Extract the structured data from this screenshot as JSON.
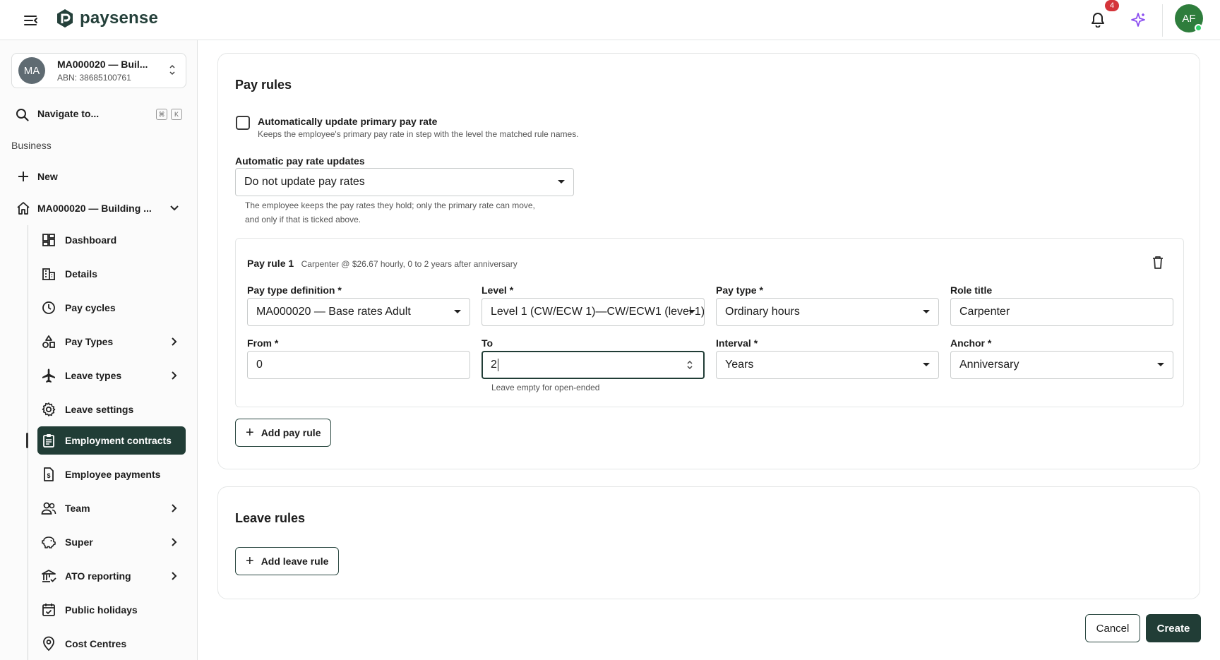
{
  "header": {
    "logo_text": "paysense",
    "notification_count": "4",
    "user_initials": "AF"
  },
  "sidebar": {
    "business": {
      "initials": "MA",
      "name": "MA000020 — Buil...",
      "abn": "ABN: 38685100761"
    },
    "navigate": {
      "label": "Navigate to...",
      "key1": "⌘",
      "key2": "K"
    },
    "section_label": "Business",
    "new_label": "New",
    "company_label": "MA000020 — Building ...",
    "items": [
      {
        "label": "Dashboard"
      },
      {
        "label": "Details"
      },
      {
        "label": "Pay cycles"
      },
      {
        "label": "Pay Types"
      },
      {
        "label": "Leave types"
      },
      {
        "label": "Leave settings"
      },
      {
        "label": "Employment contracts"
      },
      {
        "label": "Employee payments"
      },
      {
        "label": "Team"
      },
      {
        "label": "Super"
      },
      {
        "label": "ATO reporting"
      },
      {
        "label": "Public holidays"
      },
      {
        "label": "Cost Centres"
      }
    ]
  },
  "pay_rules": {
    "title": "Pay rules",
    "auto_update_label": "Automatically update primary pay rate",
    "auto_update_help": "Keeps the employee's primary pay rate in step with the level the matched rule names.",
    "auto_updates_label": "Automatic pay rate updates",
    "auto_updates_value": "Do not update pay rates",
    "auto_updates_help_1": "The employee keeps the pay rates they hold; only the primary rate can move,",
    "auto_updates_help_2": "and only if that is ticked above.",
    "rule": {
      "title": "Pay rule 1",
      "summary": "Carpenter @ $26.67 hourly, 0 to 2 years after anniversary",
      "pay_type_def_label": "Pay type definition *",
      "pay_type_def_value": "MA000020 — Base rates Adult",
      "level_label": "Level *",
      "level_value": "Level 1 (CW/ECW 1)—CW/ECW1 (level 1)",
      "pay_type_label": "Pay type *",
      "pay_type_value": "Ordinary hours",
      "role_title_label": "Role title",
      "role_title_value": "Carpenter",
      "from_label": "From *",
      "from_value": "0",
      "to_label": "To",
      "to_value": "2",
      "to_help": "Leave empty for open-ended",
      "interval_label": "Interval *",
      "interval_value": "Years",
      "anchor_label": "Anchor *",
      "anchor_value": "Anniversary"
    },
    "add_button": "Add pay rule"
  },
  "leave_rules": {
    "title": "Leave rules",
    "add_button": "Add leave rule"
  },
  "footer": {
    "cancel": "Cancel",
    "create": "Create"
  },
  "colors": {
    "primary": "#213d36",
    "badge": "#d4343a",
    "avatar": "#2e7d3c",
    "sparkle": "#8a4cf0"
  }
}
